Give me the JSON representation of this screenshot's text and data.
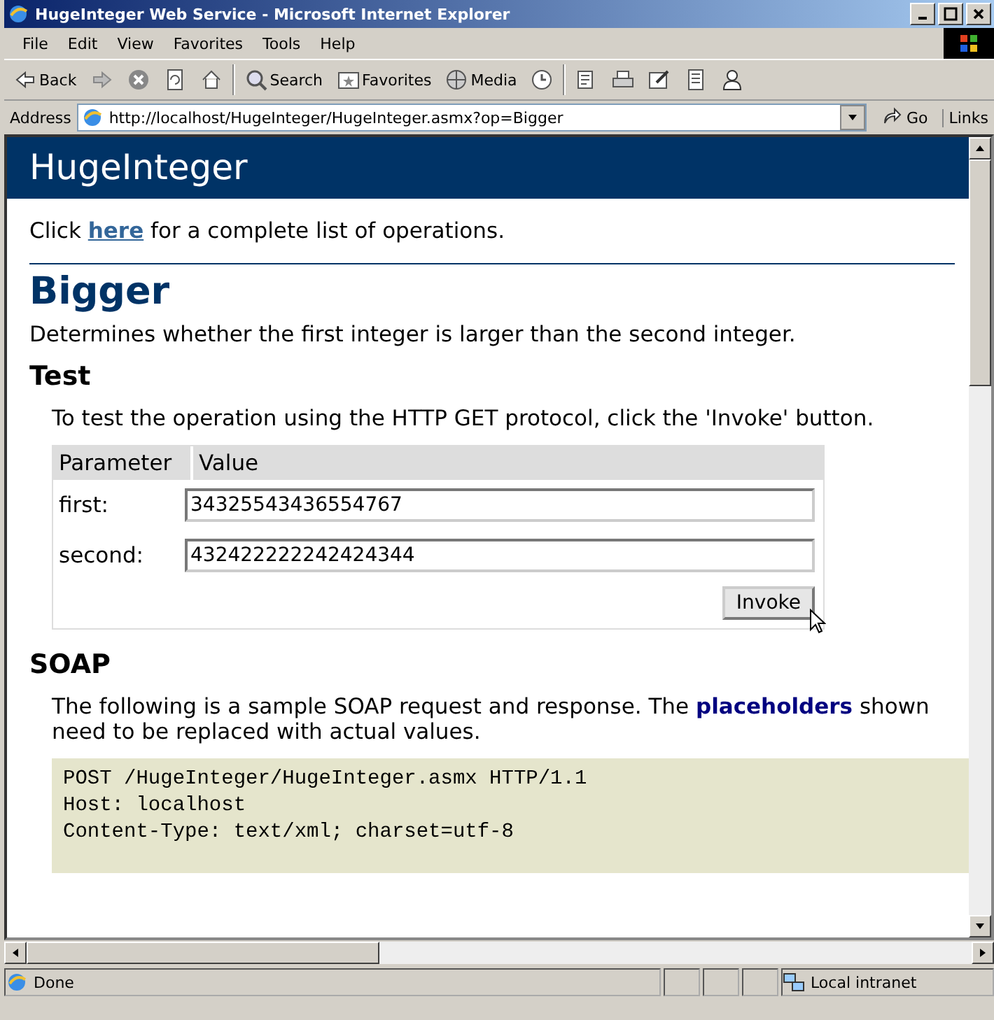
{
  "window": {
    "title": "HugeInteger Web Service - Microsoft Internet Explorer"
  },
  "menu": [
    "File",
    "Edit",
    "View",
    "Favorites",
    "Tools",
    "Help"
  ],
  "toolbar": [
    {
      "kind": "back",
      "label": "Back"
    },
    {
      "kind": "forward"
    },
    {
      "kind": "stop"
    },
    {
      "kind": "refresh"
    },
    {
      "kind": "home"
    },
    {
      "kind": "search",
      "label": "Search"
    },
    {
      "kind": "favorites",
      "label": "Favorites"
    },
    {
      "kind": "media",
      "label": "Media"
    },
    {
      "kind": "history"
    },
    {
      "kind": "mail"
    },
    {
      "kind": "print"
    },
    {
      "kind": "edit"
    },
    {
      "kind": "discuss"
    },
    {
      "kind": "messenger"
    }
  ],
  "address": {
    "label": "Address",
    "value": "http://localhost/HugeInteger/HugeInteger.asmx?op=Bigger",
    "go": "Go",
    "links": "Links"
  },
  "page": {
    "banner": "HugeInteger",
    "intro": {
      "before": "Click",
      "link": "here",
      "after": "for a complete list of operations."
    },
    "heading": "Bigger",
    "description": "Determines whether the first integer is larger than the second integer.",
    "test": {
      "heading": "Test",
      "text": "To test the operation using the HTTP GET protocol, click the 'Invoke' button.",
      "columns": [
        "Parameter",
        "Value"
      ],
      "rows": [
        {
          "name": "first:",
          "value": "34325543436554767"
        },
        {
          "name": "second:",
          "value": "432422222242424344"
        }
      ],
      "button": "Invoke"
    },
    "soap": {
      "heading": "SOAP",
      "text_before": "The following is a sample SOAP request and response. The",
      "link": "placeholders",
      "text_after": "shown need to be replaced with actual values.",
      "code": [
        "POST /HugeInteger/HugeInteger.asmx HTTP/1.1",
        "Host: localhost",
        "Content-Type: text/xml; charset=utf-8"
      ]
    }
  },
  "status_bar": {
    "text": "Done",
    "zone": "Local intranet"
  }
}
